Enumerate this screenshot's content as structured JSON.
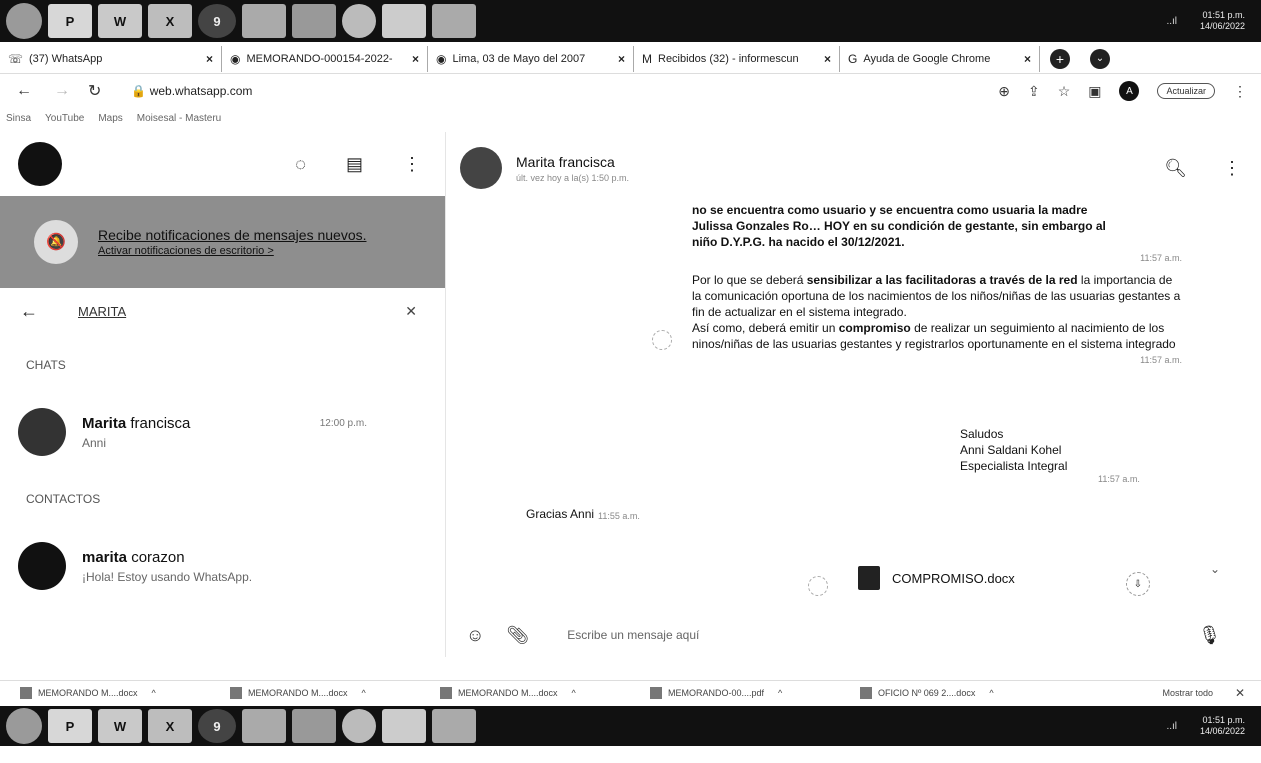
{
  "taskbar": {
    "apps": [
      "P",
      "W",
      "X"
    ],
    "network": "..ıl",
    "clock_time": "01:51 p.m.",
    "clock_date": "14/06/2022"
  },
  "tabs": [
    {
      "label": "(37) WhatsApp",
      "icon": "whatsapp-icon"
    },
    {
      "label": "MEMORANDO-000154-2022-",
      "icon": "chrome-icon"
    },
    {
      "label": "Lima, 03 de Mayo del 2007",
      "icon": "chrome-icon"
    },
    {
      "label": "Recibidos (32) - informescun",
      "icon": "gmail-icon"
    },
    {
      "label": "Ayuda de Google Chrome",
      "icon": "google-icon"
    }
  ],
  "address": {
    "url": "web.whatsapp.com",
    "update_label": "Actualizar",
    "profile_letter": "A"
  },
  "bookmarks": [
    "Sinsa",
    "YouTube",
    "Maps",
    "Moisesal - Masteru"
  ],
  "left": {
    "notification": {
      "title": "Recibe notificaciones de mensajes nuevos.",
      "subtitle": "Activar notificaciones de escritorio >"
    },
    "search_query": "MARITA",
    "chats_label": "CHATS",
    "chat": {
      "name_bold": "Marita",
      "name_rest": " francisca",
      "preview": "Anni",
      "time": "12:00 p.m."
    },
    "contacts_label": "CONTACTOS",
    "contact": {
      "name_bold": "marita",
      "name_rest": " corazon",
      "preview": "¡Hola! Estoy usando WhatsApp."
    }
  },
  "conversation": {
    "name": "Marita francisca",
    "status": "últ. vez hoy a la(s) 1:50 p.m.",
    "message1": {
      "line1": "no se encuentra como usuario y se encuentra como usuaria la madre",
      "line2": "Julissa Gonzales Ro… HOY en su condición de gestante, sin embargo al",
      "line3": "niño D.Y.P.G. ha nacido el 30/12/2021.",
      "time": "11:57 a.m."
    },
    "message2": {
      "p1_start": "Por lo que se deberá ",
      "p1_bold": "sensibilizar a las facilitadoras a través de la red",
      "p1_rest": " la importancia de la comunicación oportuna de los nacimientos de los niños/niñas de las usuarias gestantes a fin de actualizar en el sistema integrado.",
      "p2_start": "Así como, deberá emitir un ",
      "p2_bold": "compromiso",
      "p2_rest": " de realizar un seguimiento al nacimiento de los ninos/niñas de las usuarias gestantes y registrarlos oportunamente en el sistema integrado",
      "time": "11:57 a.m."
    },
    "signature": {
      "l1": "Saludos",
      "l2": "Anni Saldani Kohel",
      "l3": "Especialista Integral",
      "time": "11:57 a.m."
    },
    "reply": {
      "text": "Gracias Anni",
      "time": "11:55 a.m."
    },
    "document": {
      "name": "COMPROMISO.docx"
    },
    "composer_placeholder": "Escribe un mensaje aquí"
  },
  "downloads": {
    "items": [
      "MEMORANDO M....docx",
      "MEMORANDO M....docx",
      "MEMORANDO M....docx",
      "MEMORANDO-00....pdf",
      "OFICIO Nº 069 2....docx"
    ],
    "show_all": "Mostrar todo"
  }
}
